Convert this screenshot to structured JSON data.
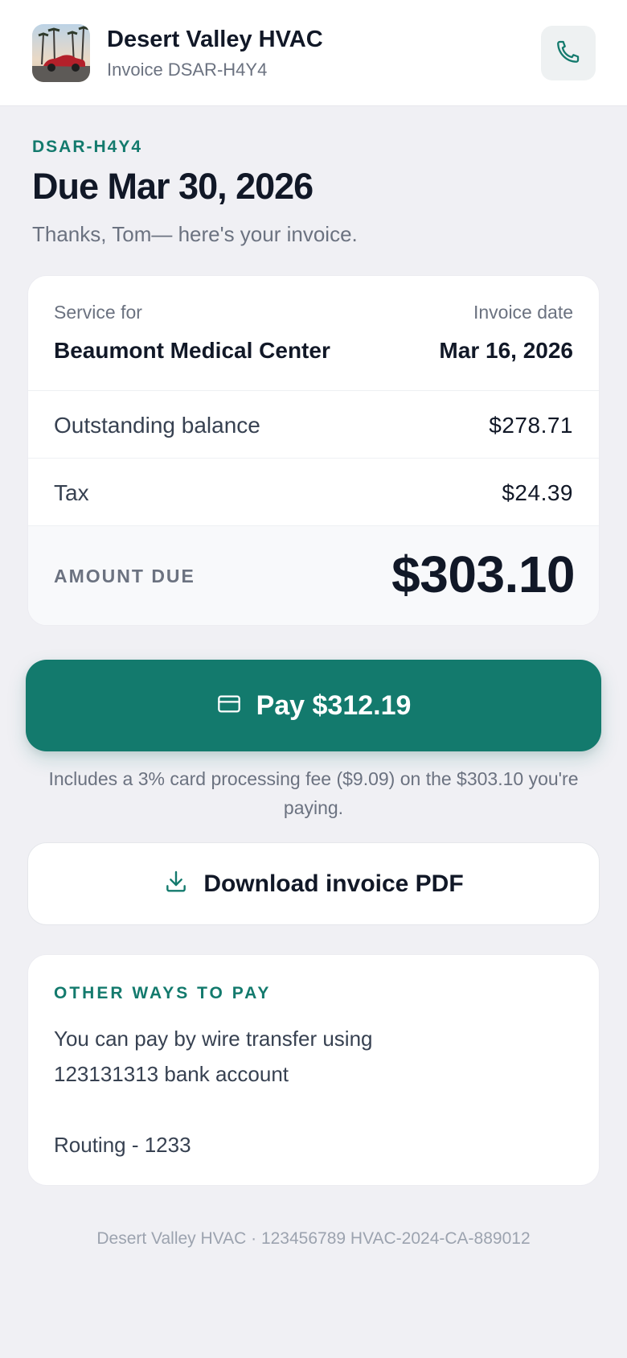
{
  "header": {
    "business_name": "Desert Valley HVAC",
    "invoice_label": "Invoice DSAR-H4Y4",
    "phone_icon": "phone-icon",
    "logo": "business-logo"
  },
  "summary": {
    "reference": "DSAR-H4Y4",
    "due": "Due Mar 30, 2026",
    "thanks": "Thanks, Tom— here's your invoice."
  },
  "invoice": {
    "service_for_label": "Service for",
    "service_for_value": "Beaumont Medical Center",
    "invoice_date_label": "Invoice date",
    "invoice_date_value": "Mar 16, 2026",
    "outstanding_label": "Outstanding balance",
    "outstanding_value": "$278.71",
    "tax_label": "Tax",
    "tax_value": "$24.39",
    "amount_due_label": "AMOUNT DUE",
    "amount_due_value": "$303.10"
  },
  "pay": {
    "label": "Pay $312.19",
    "icon": "credit-card-icon",
    "fee_note": "Includes a 3% card processing fee ($9.09) on the $303.10 you're paying."
  },
  "download": {
    "label": "Download invoice PDF",
    "icon": "download-icon"
  },
  "other_ways": {
    "title": "OTHER WAYS TO PAY",
    "body": "You can pay by wire transfer using\n123131313 bank account\n\nRouting - 1233"
  },
  "footer": {
    "text": "Desert Valley HVAC · 123456789 HVAC-2024-CA-889012"
  },
  "colors": {
    "accent": "#137a6d",
    "background": "#f0f0f4",
    "text": "#111827",
    "muted": "#6b7280"
  }
}
